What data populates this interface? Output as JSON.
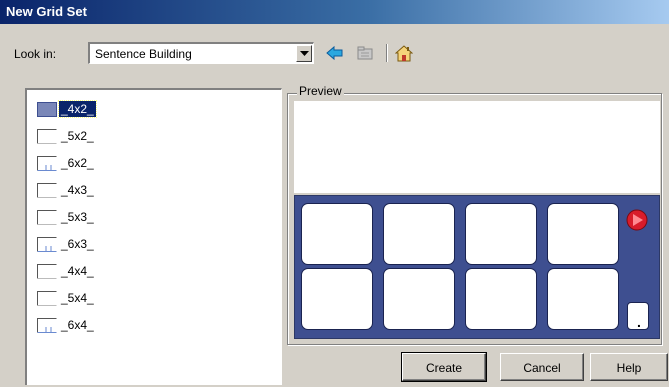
{
  "window": {
    "title": "New Grid Set"
  },
  "lookin": {
    "label": "Look in:",
    "value": "Sentence Building",
    "icons": [
      "back-arrow-icon",
      "folder-up-icon",
      "home-icon"
    ]
  },
  "grid_list": [
    {
      "label": "_4x2_",
      "selected": true
    },
    {
      "label": "_5x2_",
      "selected": false
    },
    {
      "label": "_6x2_",
      "selected": false
    },
    {
      "label": "_4x3_",
      "selected": false
    },
    {
      "label": "_5x3_",
      "selected": false
    },
    {
      "label": "_6x3_",
      "selected": false
    },
    {
      "label": "_4x4_",
      "selected": false
    },
    {
      "label": "_5x4_",
      "selected": false
    },
    {
      "label": "_6x4_",
      "selected": false
    }
  ],
  "preview": {
    "legend": "Preview",
    "rows": 2,
    "cols": 4,
    "grid_color": "#3e4f90",
    "nav_icon": "red-play-arrow-icon",
    "corner_label": "."
  },
  "buttons": {
    "create": "Create",
    "cancel": "Cancel",
    "help": "Help"
  },
  "colors": {
    "titlebar": "#0a246a",
    "selection": "#0a246a",
    "dialog": "#d4d0c8"
  }
}
